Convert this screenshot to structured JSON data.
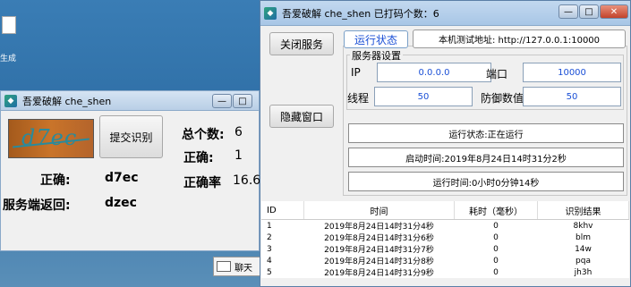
{
  "desktop": {
    "icon_label": "生成"
  },
  "left_window": {
    "title": "吾爱破解  che_shen",
    "captcha_text": "d7ec",
    "submit_button": "提交识别",
    "total_label": "总个数:",
    "total_value": "6",
    "correct_count_label": "正确:",
    "correct_count_value": "1",
    "rate_label": "正确率",
    "rate_value": "16.6",
    "correct_label": "正确:",
    "correct_value": "d7ec",
    "server_return_label": "服务端返回:",
    "server_return_value": "dzec"
  },
  "taskbar": {
    "chat_label": "聊天"
  },
  "right_window": {
    "title": "吾爱破解  che_shen  已打码个数：6",
    "close_service_button": "关闭服务",
    "status_tab": "运行状态",
    "test_address_label": "本机测试地址: http://127.0.0.1:10000",
    "server_settings_label": "服务器设置",
    "ip_label": "IP",
    "ip_value": "0.0.0.0",
    "port_label": "端口",
    "port_value": "10000",
    "threads_label": "线程",
    "threads_value": "50",
    "defense_label": "防御数值",
    "defense_value": "50",
    "hide_window_button": "隐藏窗口",
    "run_status": "运行状态:正在运行",
    "start_time": "启动时间:2019年8月24日14时31分2秒",
    "run_time": "运行时间:0小时0分钟14秒",
    "log_headers": [
      "ID",
      "时间",
      "耗时（毫秒）",
      "识别结果"
    ],
    "log_rows": [
      [
        "1",
        "2019年8月24日14时31分4秒",
        "0",
        "8khv"
      ],
      [
        "2",
        "2019年8月24日14时31分6秒",
        "0",
        "blm"
      ],
      [
        "3",
        "2019年8月24日14时31分7秒",
        "0",
        "14w"
      ],
      [
        "4",
        "2019年8月24日14时31分8秒",
        "0",
        "pqa"
      ],
      [
        "5",
        "2019年8月24日14时31分9秒",
        "0",
        "jh3h"
      ]
    ]
  }
}
